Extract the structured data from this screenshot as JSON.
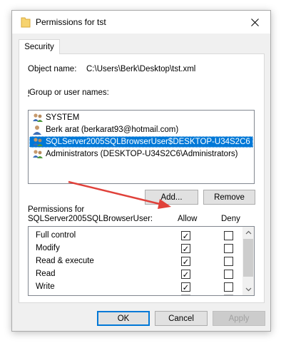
{
  "window": {
    "title": "Permissions for tst"
  },
  "tabs": [
    {
      "label": "Security"
    }
  ],
  "object": {
    "label": "Object name:",
    "value": "C:\\Users\\Berk\\Desktop\\tst.xml"
  },
  "users": {
    "label": "Group or user names:",
    "items": [
      {
        "name": "SYSTEM",
        "icon": "group-icon",
        "selected": false
      },
      {
        "name": "Berk arat (berkarat93@hotmail.com)",
        "icon": "user-icon",
        "selected": false
      },
      {
        "name": "SQLServer2005SQLBrowserUser$DESKTOP-U34S2C6 (D...",
        "icon": "group-icon",
        "selected": true
      },
      {
        "name": "Administrators (DESKTOP-U34S2C6\\Administrators)",
        "icon": "group-icon",
        "selected": false
      }
    ]
  },
  "buttons": {
    "add": "Add...",
    "remove": "Remove",
    "ok": "OK",
    "cancel": "Cancel",
    "apply": "Apply"
  },
  "permissions": {
    "label_line1": "Permissions for",
    "label_line2": "SQLServer2005SQLBrowserUser:",
    "allow_header": "Allow",
    "deny_header": "Deny",
    "items": [
      {
        "name": "Full control",
        "allow": true,
        "deny": false
      },
      {
        "name": "Modify",
        "allow": true,
        "deny": false
      },
      {
        "name": "Read & execute",
        "allow": true,
        "deny": false
      },
      {
        "name": "Read",
        "allow": true,
        "deny": false
      },
      {
        "name": "Write",
        "allow": true,
        "deny": false
      }
    ]
  },
  "colors": {
    "selection": "#0078d7",
    "annotation_arrow": "#e0413a",
    "folder": "#f6d36f"
  }
}
